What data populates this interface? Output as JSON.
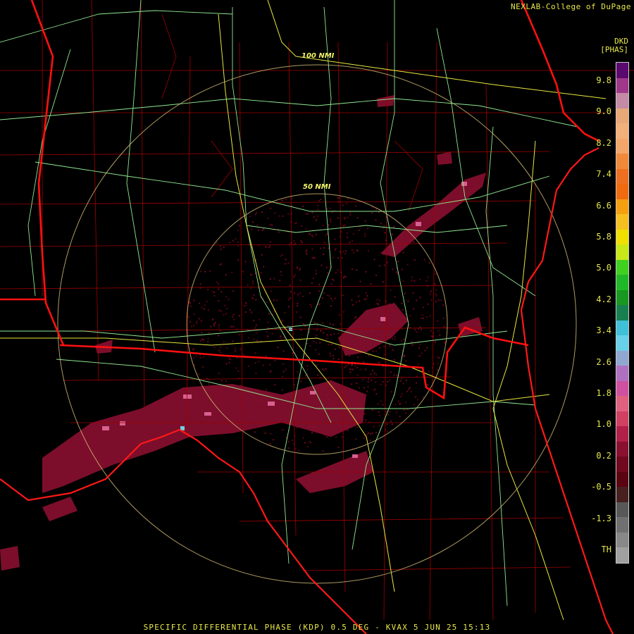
{
  "header": {
    "credit": "NEXLAB-College of DuPage"
  },
  "legend": {
    "unit_line1": "DKD",
    "unit_line2": "[PHAS]",
    "labels": [
      "9.8",
      "9.0",
      "8.2",
      "7.4",
      "6.6",
      "5.8",
      "5.0",
      "4.2",
      "3.4",
      "2.6",
      "1.8",
      "1.0",
      "0.2",
      "-0.5",
      "-1.3",
      "TH"
    ],
    "colors": [
      "#5a0a6e",
      "#a0388a",
      "#c48aa6",
      "#e8a878",
      "#f2b07a",
      "#f3a66a",
      "#f08a3a",
      "#ec7020",
      "#f06a10",
      "#f5a010",
      "#f6c020",
      "#f0e000",
      "#c8e818",
      "#40d020",
      "#20b828",
      "#189820",
      "#188050",
      "#40c0d8",
      "#68d0e8",
      "#90a8d0",
      "#b070c0",
      "#d050a0",
      "#e06080",
      "#d04060",
      "#b02048",
      "#8a1030",
      "#70081e",
      "#5a0412",
      "#482020",
      "#585858",
      "#707070",
      "#888888",
      "#a0a0a0"
    ]
  },
  "map": {
    "ring_labels": [
      "100 NMI",
      "50 NMI"
    ]
  },
  "footer": {
    "product": "SPECIFIC DIFFERENTIAL PHASE (KDP) 0.5 DEG - KVAX 5 JUN 25 15:13"
  }
}
